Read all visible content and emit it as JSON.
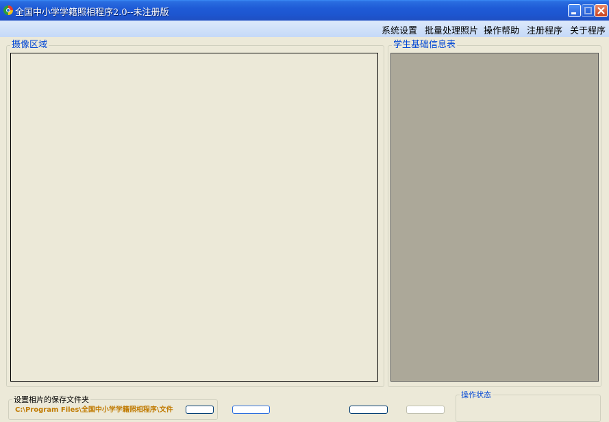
{
  "window": {
    "title": "全国中小学学籍照相程序2.0--未注册版",
    "controls": [
      "minimize-icon",
      "maximize-icon",
      "close-icon"
    ]
  },
  "menu": {
    "items": [
      "系统设置",
      "批量处理照片",
      "操作帮助",
      "注册程序",
      "关于程序"
    ]
  },
  "camera_group": {
    "title": "摄像区域"
  },
  "info_group": {
    "title": "学生基础信息表"
  },
  "save_group": {
    "title": "设置相片的保存文件夹",
    "path": "C:\\Program Files\\全国中小学学籍照相程序\\文件"
  },
  "status_group": {
    "title": "操作状态"
  },
  "colors": {
    "titlebar": "#1f5bd6",
    "menubar": "#c5d9f7",
    "window_bg": "#ece9d8",
    "info_panel": "#aca899",
    "group_title": "#0046d5",
    "path_text": "#c07a00"
  }
}
